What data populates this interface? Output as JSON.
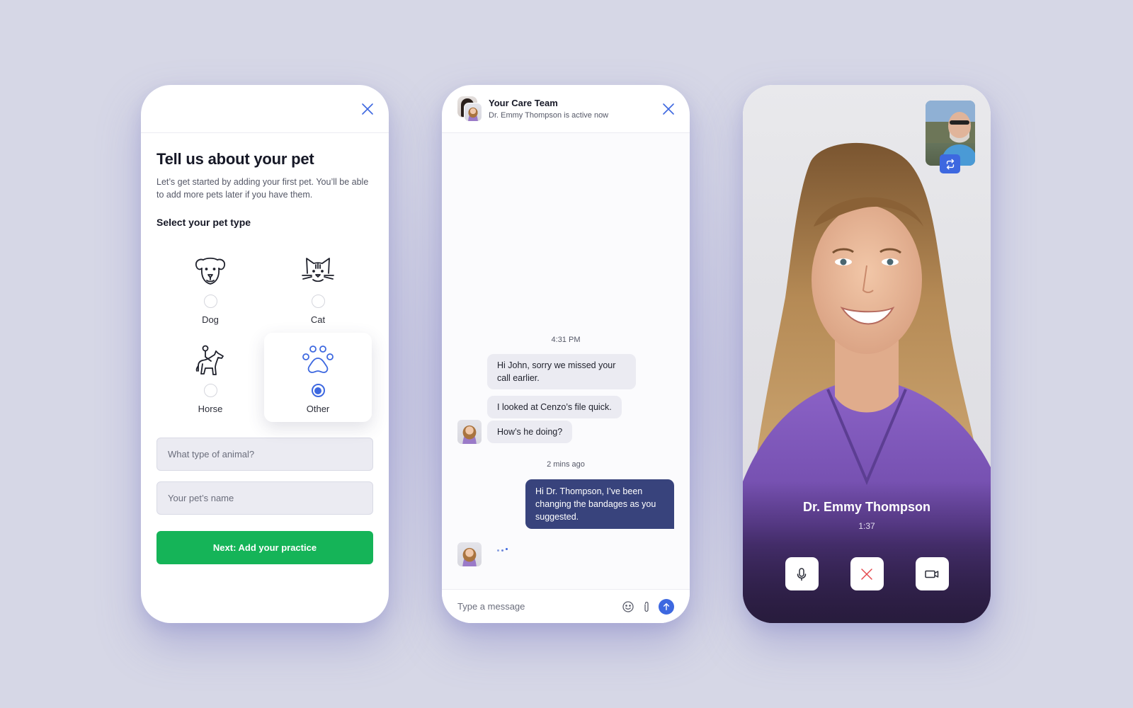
{
  "onboarding": {
    "title": "Tell us about your pet",
    "subtitle": "Let’s get started by adding your first pet. You’ll be able to add more pets later if you have them.",
    "section_label": "Select your pet type",
    "pet_types": [
      {
        "label": "Dog",
        "icon": "dog-icon",
        "selected": false
      },
      {
        "label": "Cat",
        "icon": "cat-icon",
        "selected": false
      },
      {
        "label": "Horse",
        "icon": "horse-rider-icon",
        "selected": false
      },
      {
        "label": "Other",
        "icon": "paw-icon",
        "selected": true
      }
    ],
    "animal_type_placeholder": "What type of animal?",
    "pet_name_placeholder": "Your pet’s name",
    "next_button": "Next: Add your practice",
    "colors": {
      "accent": "#3d68e0",
      "primary_button": "#15b458"
    }
  },
  "chat": {
    "title": "Your Care Team",
    "status": "Dr. Emmy Thompson is active now",
    "messages": [
      {
        "time": "4:31 PM"
      },
      {
        "from": "Dr. Emmy Thompson",
        "text": "Hi John, sorry we missed your call earlier."
      },
      {
        "from": "Dr. Emmy Thompson",
        "text": "I looked at Cenzo’s file quick."
      },
      {
        "from": "Dr. Emmy Thompson",
        "text": "How’s he doing?"
      },
      {
        "time": "2 mins ago"
      },
      {
        "from": "me",
        "text": "Hi Dr. Thompson, I’ve been changing the bandages as you suggested."
      }
    ],
    "typing_indicator": true,
    "input_placeholder": "Type a message",
    "colors": {
      "my_bubble": "#38437c",
      "their_bubble": "#ebebf2",
      "send": "#3d68e0"
    }
  },
  "video_call": {
    "caller_name": "Dr. Emmy Thompson",
    "duration": "1:37",
    "controls": [
      "microphone",
      "end-call",
      "camera"
    ],
    "colors": {
      "end_call": "#e5484d",
      "switch_camera": "#3d68e0"
    }
  }
}
